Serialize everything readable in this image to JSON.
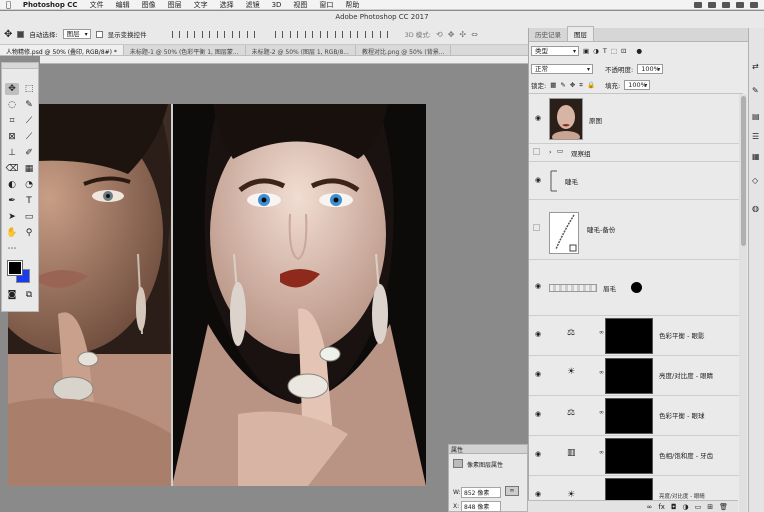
{
  "menubar": {
    "app": "Photoshop CC",
    "items": [
      "文件",
      "编辑",
      "图像",
      "图层",
      "文字",
      "选择",
      "滤镜",
      "3D",
      "视图",
      "窗口",
      "帮助"
    ]
  },
  "window_title": "Adobe Photoshop CC 2017",
  "options": {
    "auto_select_label": "自动选择:",
    "auto_select_value": "图层",
    "show_transform_label": "显示变换控件",
    "mode3d": "3D 模式:"
  },
  "doc_tabs": [
    "人物精修.psd @ 50% (叠印, RGB/8#) *",
    "未标题-1 @ 50% (色彩平衡 1, 图层蒙...",
    "未标题-2 @ 50% (图层 1, RGB/8...",
    "教程对比.png @ 50% (背景..."
  ],
  "panel": {
    "tabs": [
      "历史记录",
      "图层"
    ],
    "kind_value": "类型",
    "blend_mode": "正常",
    "opacity_label": "不透明度:",
    "opacity_value": "100%",
    "lock_label": "锁定:",
    "fill_label": "填充:",
    "fill_value": "100%",
    "layers": [
      {
        "name": "原图",
        "kind": "photo",
        "visible": true
      },
      {
        "name": "观察组",
        "kind": "group",
        "visible": false
      },
      {
        "name": "睫毛",
        "kind": "plain",
        "visible": true
      },
      {
        "name": "睫毛-备份",
        "kind": "sketch",
        "visible": false
      },
      {
        "name": "眉毛",
        "kind": "brow",
        "visible": true
      },
      {
        "name": "色彩平衡 - 眼影",
        "kind": "balance",
        "visible": true
      },
      {
        "name": "亮度/对比度 - 眼睛",
        "kind": "brightness",
        "visible": true
      },
      {
        "name": "色彩平衡 - 眼球",
        "kind": "balance",
        "visible": true
      },
      {
        "name": "色相/饱和度 - 牙齿",
        "kind": "huesat",
        "visible": true
      },
      {
        "name": "亮度/对比度 - 眼睛",
        "kind": "brightness",
        "visible": true
      }
    ]
  },
  "properties": {
    "tab": "属性",
    "title": "像素图层属性",
    "w_label": "W:",
    "w_value": "852 像素",
    "x_label": "X:",
    "x_value": "848 像素"
  },
  "colors": {
    "foreground": "#000000",
    "background": "#1a3cf0",
    "lip": "#8e2a1c",
    "iris": "#3f8fd0"
  }
}
